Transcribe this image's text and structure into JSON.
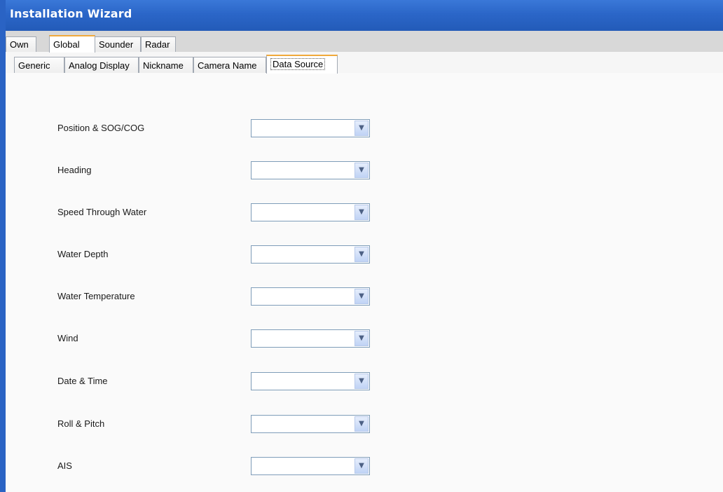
{
  "window": {
    "title": "Installation Wizard"
  },
  "tabs_primary": [
    {
      "label": "Own",
      "active": false
    },
    {
      "label": "Global",
      "active": true
    },
    {
      "label": "Sounder",
      "active": false
    },
    {
      "label": "Radar",
      "active": false
    }
  ],
  "tabs_secondary": [
    {
      "label": "Generic",
      "active": false
    },
    {
      "label": "Analog Display",
      "active": false
    },
    {
      "label": "Nickname",
      "active": false
    },
    {
      "label": "Camera Name",
      "active": false
    },
    {
      "label": "Data Source",
      "active": true
    }
  ],
  "data_source": {
    "fields": [
      {
        "label": "Position & SOG/COG",
        "value": ""
      },
      {
        "label": "Heading",
        "value": ""
      },
      {
        "label": "Speed Through Water",
        "value": ""
      },
      {
        "label": "Water Depth",
        "value": ""
      },
      {
        "label": "Water Temperature",
        "value": ""
      },
      {
        "label": "Wind",
        "value": ""
      },
      {
        "label": "Date & Time",
        "value": ""
      },
      {
        "label": "Roll & Pitch",
        "value": ""
      },
      {
        "label": "AIS",
        "value": ""
      }
    ],
    "dropdown_icon": "chevron-down-icon"
  },
  "colors": {
    "titlebar": "#2b66c8",
    "active_tab_accent": "#f0a93b",
    "combo_border": "#7f9db9"
  }
}
